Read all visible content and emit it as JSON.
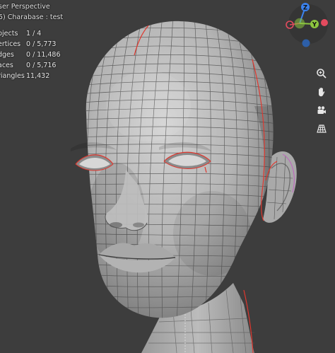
{
  "header": {
    "title": "ser Perspective",
    "object_line": "5) Charabase : test"
  },
  "stats": [
    {
      "label": "bjects",
      "value": "1 / 4"
    },
    {
      "label": "ertices",
      "value": "0 / 5,773"
    },
    {
      "label": "dges",
      "value": "0 / 11,486"
    },
    {
      "label": "aces",
      "value": "0 / 5,716"
    },
    {
      "label": "riangles",
      "value": "11,432"
    }
  ],
  "gizmo": {
    "z_label": "Z",
    "y_label": "Y",
    "colors": {
      "x": "#e34b5e",
      "y": "#8cc63f",
      "z": "#3b82ee",
      "neg_z": "#2d5fa8"
    }
  },
  "toolbar": {
    "zoom_icon": "zoom-in-icon",
    "pan_icon": "hand-pan-icon",
    "camera_icon": "camera-icon",
    "grid_icon": "perspective-grid-icon"
  },
  "colors": {
    "background": "#3d3d3d",
    "mesh": "#b9b9b9",
    "wire": "#4a4a4a",
    "seam": "#e0372e"
  }
}
